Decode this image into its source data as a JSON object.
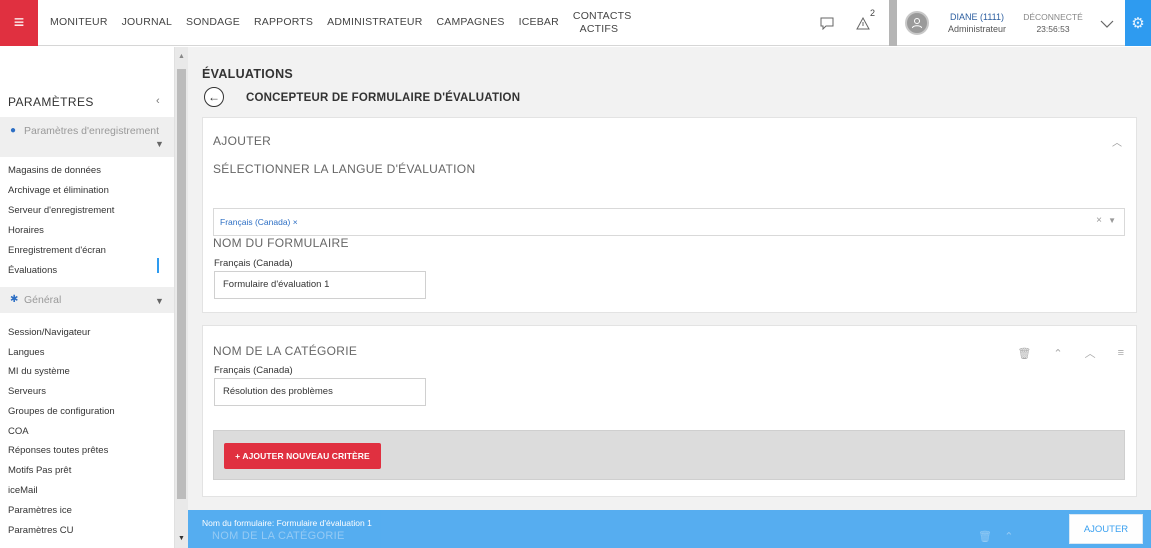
{
  "topbar": {
    "nav": [
      "MONITEUR",
      "JOURNAL",
      "SONDAGE",
      "RAPPORTS",
      "ADMINISTRATEUR",
      "CAMPAGNES",
      "ICEBAR"
    ],
    "contacts_line1": "CONTACTS",
    "contacts_line2": "ACTIFS",
    "alert_count": "2",
    "user_name": "DIANE (1111)",
    "user_role": "Administrateur",
    "logout_label": "DÉCONNECTÉ",
    "logout_time": "23:56:53",
    "colors": {
      "accent_red": "#e03040",
      "accent_blue": "#2e9bf0"
    }
  },
  "sidebar": {
    "title": "PARAMÈTRES",
    "section1": "Paramètres d'enregistrement",
    "section1_items": [
      "Magasins de données",
      "Archivage et élimination",
      "Serveur d'enregistrement",
      "Horaires",
      "Enregistrement d'écran",
      "Évaluations"
    ],
    "section2": "Général",
    "section2_items": [
      "Session/Navigateur",
      "Langues",
      "MI du système",
      "Serveurs",
      "Groupes de configuration",
      "COA",
      "Réponses toutes prêtes",
      "Motifs Pas prêt",
      "iceMail",
      "Paramètres ice",
      "Paramètres CU"
    ]
  },
  "main": {
    "title": "ÉVALUATIONS",
    "subtitle": "CONCEPTEUR DE FORMULAIRE D'ÉVALUATION",
    "add_panel": {
      "heading": "AJOUTER",
      "lang_heading": "SÉLECTIONNER LA LANGUE D'ÉVALUATION",
      "lang_tag": "Français (Canada) ×",
      "form_name_heading": "NOM DU FORMULAIRE",
      "form_lang_label": "Français (Canada)",
      "form_name_value": "Formulaire d'évaluation 1"
    },
    "category_panel": {
      "heading": "NOM DE LA CATÉGORIE",
      "lang_label": "Français (Canada)",
      "value": "Résolution des problèmes",
      "add_criterion": "+ AJOUTER NOUVEAU CRITÈRE"
    }
  },
  "bottom_bar": {
    "form_name_text": "Nom du formulaire: Formulaire d'évaluation 1",
    "ghost_category": "NOM DE LA CATÉGORIE",
    "add_button": "AJOUTER"
  }
}
